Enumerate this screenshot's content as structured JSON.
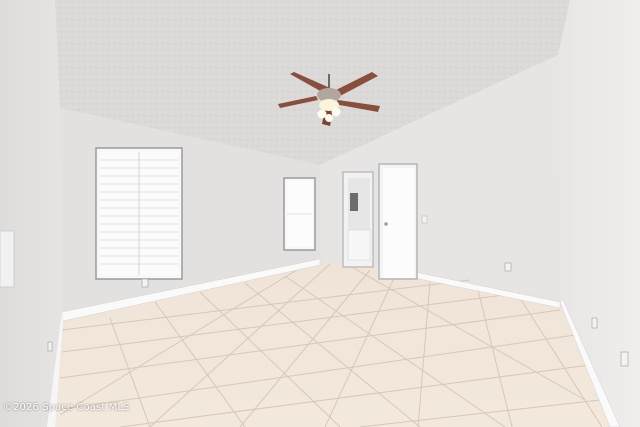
{
  "photo": {
    "subject": "empty bedroom",
    "watermark": "©2026 Space Coast MLS"
  },
  "colors": {
    "ceiling": "#dcdad9",
    "wall_left": "#e4e2e1",
    "wall_back": "#e8e6e5",
    "wall_right": "#ebe9e8",
    "floor_tile": "#f0e4d6",
    "grout": "#d8cbbb",
    "baseboard": "#fafafa",
    "fan_blade": "#8a4e3c",
    "window_glass": "#f7f7f7"
  }
}
